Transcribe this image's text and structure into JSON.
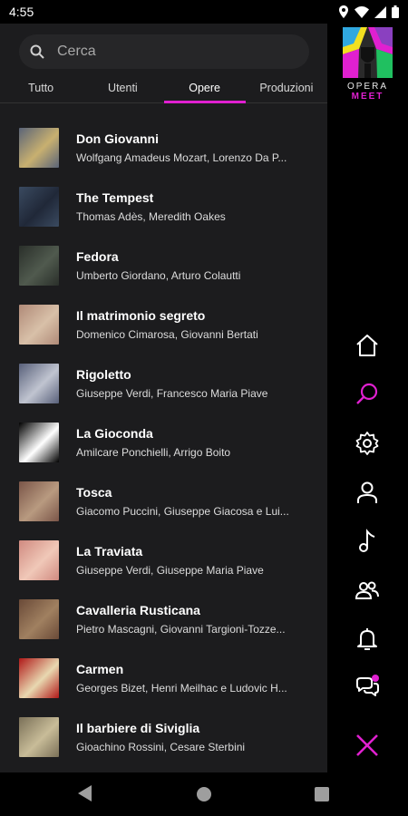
{
  "status": {
    "time": "4:55",
    "icons": [
      "location-icon",
      "wifi-icon",
      "signal-icon",
      "battery-icon"
    ]
  },
  "search": {
    "placeholder": "Cerca"
  },
  "tabs": [
    {
      "label": "Tutto",
      "active": false
    },
    {
      "label": "Utenti",
      "active": false
    },
    {
      "label": "Opere",
      "active": true
    },
    {
      "label": "Produzioni",
      "active": false
    }
  ],
  "items": [
    {
      "title": "Don Giovanni",
      "subtitle": "Wolfgang Amadeus Mozart, Lorenzo Da P...",
      "colors": [
        "#5a6478",
        "#c8b070"
      ]
    },
    {
      "title": "The Tempest",
      "subtitle": "Thomas Adès, Meredith Oakes",
      "colors": [
        "#3a4a60",
        "#202838"
      ]
    },
    {
      "title": "Fedora",
      "subtitle": "Umberto Giordano, Arturo Colautti",
      "colors": [
        "#2a2f2a",
        "#505a4e"
      ]
    },
    {
      "title": "Il matrimonio segreto",
      "subtitle": "Domenico Cimarosa, Giovanni Bertati",
      "colors": [
        "#b08a78",
        "#d8c0a8"
      ]
    },
    {
      "title": "Rigoletto",
      "subtitle": "Giuseppe Verdi, Francesco Maria Piave",
      "colors": [
        "#58607a",
        "#c0c4d0"
      ]
    },
    {
      "title": "La Gioconda",
      "subtitle": "Amilcare Ponchielli, Arrigo Boito",
      "colors": [
        "#000000",
        "#ffffff"
      ]
    },
    {
      "title": "Tosca",
      "subtitle": "Giacomo Puccini, Giuseppe Giacosa e Lui...",
      "colors": [
        "#7a5548",
        "#b89a80"
      ]
    },
    {
      "title": "La Traviata",
      "subtitle": "Giuseppe Verdi, Giuseppe Maria Piave",
      "colors": [
        "#d08a80",
        "#f0c8b8"
      ]
    },
    {
      "title": "Cavalleria Rusticana",
      "subtitle": "Pietro Mascagni, Giovanni Targioni-Tozze...",
      "colors": [
        "#6a4a38",
        "#a08060"
      ]
    },
    {
      "title": "Carmen",
      "subtitle": "Georges Bizet, Henri Meilhac e Ludovic H...",
      "colors": [
        "#b01818",
        "#e8d8b0"
      ]
    },
    {
      "title": "Il barbiere di Siviglia",
      "subtitle": "Gioachino Rossini, Cesare Sterbini",
      "colors": [
        "#7a7058",
        "#c8bc98"
      ]
    }
  ],
  "logo": {
    "line1": "OPERA",
    "line2": "MEET"
  },
  "sidebar_icons": [
    "home-icon",
    "search-icon",
    "settings-icon",
    "profile-icon",
    "music-icon",
    "group-icon",
    "notifications-icon",
    "chat-icon",
    "close-icon"
  ],
  "theme": {
    "accent": "#e020d0",
    "panel": "#1c1c1e"
  }
}
